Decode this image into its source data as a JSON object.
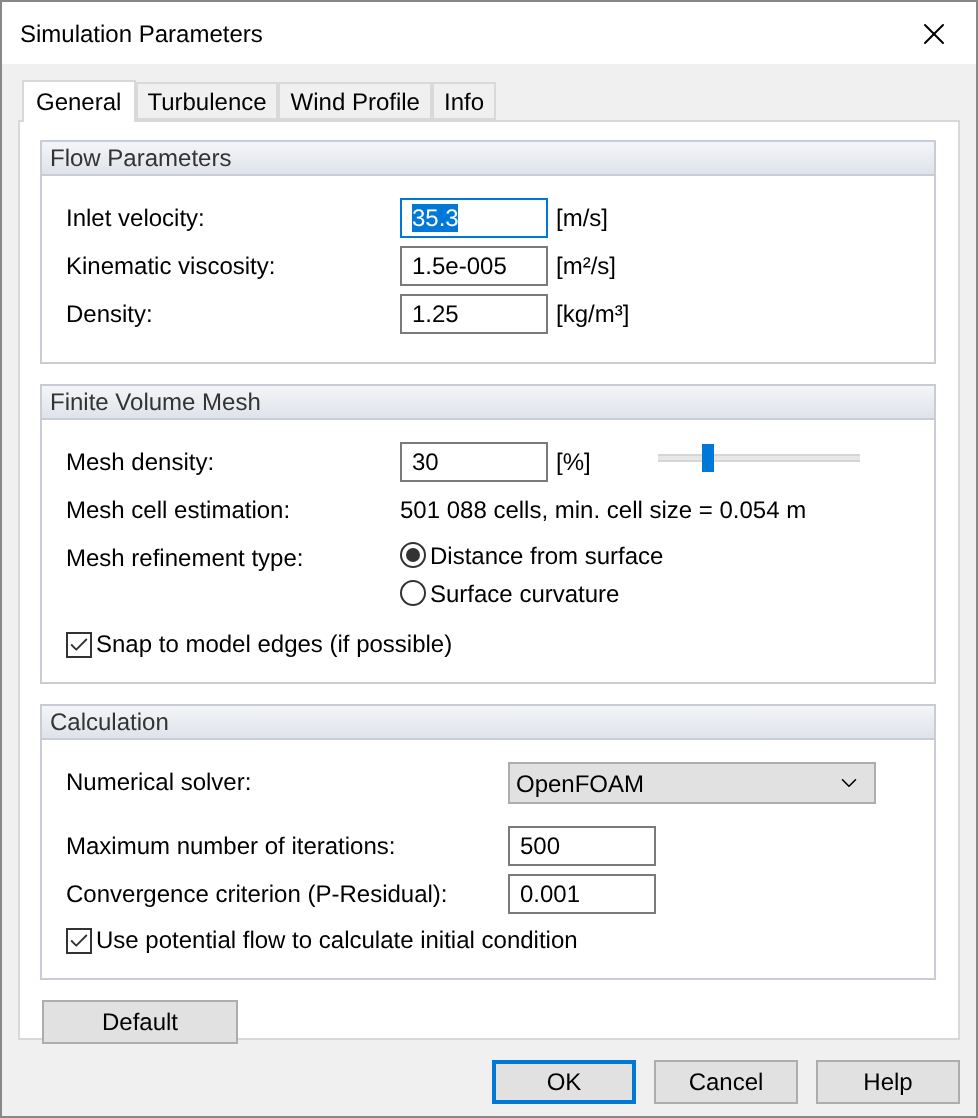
{
  "window": {
    "title": "Simulation Parameters"
  },
  "tabs": [
    {
      "label": "General",
      "selected": true
    },
    {
      "label": "Turbulence",
      "selected": false
    },
    {
      "label": "Wind Profile",
      "selected": false
    },
    {
      "label": "Info",
      "selected": false
    }
  ],
  "groups": [
    {
      "title": "Flow Parameters",
      "rows": [
        {
          "kind": "field",
          "label": "Inlet velocity:",
          "value": "35.3",
          "unit": "[m/s]",
          "focused": true
        },
        {
          "kind": "field",
          "label": "Kinematic viscosity:",
          "value": "1.5e-005",
          "unit": "[m²/s]",
          "focused": false
        },
        {
          "kind": "field",
          "label": "Density:",
          "value": "1.25",
          "unit": "[kg/m³]",
          "focused": false
        }
      ]
    },
    {
      "title": "Finite Volume Mesh",
      "rows": [
        {
          "kind": "slider",
          "label": "Mesh density:",
          "value": "30",
          "unit": "[%]",
          "focused": false,
          "level": 0.25
        },
        {
          "kind": "info",
          "label": "Mesh cell estimation:",
          "text": "501 088 cells, min. cell size = 0.054 m"
        },
        {
          "kind": "radio",
          "label": "Mesh refinement type:",
          "options": [
            {
              "label": "Distance from surface",
              "selected": true
            },
            {
              "label": "Surface curvature",
              "selected": false
            }
          ]
        },
        {
          "kind": "checkbox",
          "label": "Snap to model edges (if possible)",
          "checked": true
        }
      ]
    },
    {
      "title": "Calculation",
      "rows": [
        {
          "kind": "select",
          "label": "Numerical solver:",
          "value": "OpenFOAM"
        },
        {
          "kind": "field",
          "label": "Maximum number of iterations:",
          "value": "500",
          "focused": false
        },
        {
          "kind": "field",
          "label": "Convergence criterion (P-Residual):",
          "value": "0.001",
          "focused": false
        },
        {
          "kind": "checkbox",
          "label": "Use potential flow to calculate initial condition",
          "checked": true
        }
      ]
    }
  ],
  "default_button": "Default",
  "buttons": [
    {
      "label": "OK",
      "default": true
    },
    {
      "label": "Cancel",
      "default": false
    },
    {
      "label": "Help",
      "default": false
    }
  ]
}
